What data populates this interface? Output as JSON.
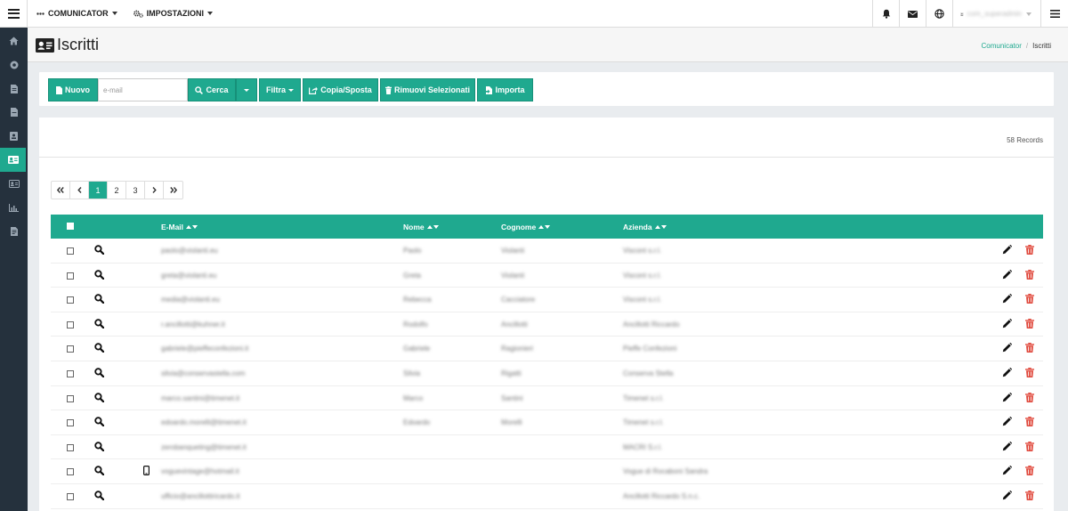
{
  "topbar": {
    "menus": [
      {
        "label": "COMUNICATOR",
        "icon": "dots-icon"
      },
      {
        "label": "IMPOSTAZIONI",
        "icon": "gears-icon"
      }
    ],
    "user_name": "com_superadmin"
  },
  "page": {
    "title": "Iscritti",
    "breadcrumb": {
      "parent": "Comunicator",
      "current": "Iscritti"
    }
  },
  "toolbar": {
    "new_label": "Nuovo",
    "email_placeholder": "e-mail",
    "search_label": "Cerca",
    "filter_label": "Filtra",
    "copy_move_label": "Copia/Sposta",
    "remove_selected_label": "Rimuovi Selezionati",
    "import_label": "Importa"
  },
  "records_label": "58 Records",
  "pagination": {
    "pages": [
      "1",
      "2",
      "3"
    ],
    "current": "1"
  },
  "table": {
    "columns": {
      "email": "E-Mail",
      "name": "Nome",
      "surname": "Cognome",
      "company": "Azienda"
    },
    "rows": [
      {
        "email": "paolo@violanti.eu",
        "name": "Paolo",
        "surname": "Violanti",
        "company": "Viscont s.r.l.",
        "mobile": false
      },
      {
        "email": "greta@violanti.eu",
        "name": "Greta",
        "surname": "Violanti",
        "company": "Viscont s.r.l.",
        "mobile": false
      },
      {
        "email": "media@violanti.eu",
        "name": "Rebecca",
        "surname": "Cacciatore",
        "company": "Viscont s.r.l.",
        "mobile": false
      },
      {
        "email": "r.ancillotti@kuhner.it",
        "name": "Rodolfo",
        "surname": "Ancillotti",
        "company": "Ancillotti Riccardo",
        "mobile": false
      },
      {
        "email": "gabriele@pieffeconfezioni.it",
        "name": "Gabriele",
        "surname": "Ragionieri",
        "company": "Pieffe Confezioni",
        "mobile": false
      },
      {
        "email": "silvia@conservastella.com",
        "name": "Silvia",
        "surname": "Rigatti",
        "company": "Conserva Stella",
        "mobile": false
      },
      {
        "email": "marco.santini@timenet.it",
        "name": "Marco",
        "surname": "Santini",
        "company": "Timenet s.r.l.",
        "mobile": false
      },
      {
        "email": "edoardo.morelli@timenet.it",
        "name": "Edoardo",
        "surname": "Morelli",
        "company": "Timenet s.r.l.",
        "mobile": false
      },
      {
        "email": "zerobanqueting@timenet.it",
        "name": "",
        "surname": "",
        "company": "MACRI S.r.l.",
        "mobile": false
      },
      {
        "email": "voguevintage@hotmail.it",
        "name": "",
        "surname": "",
        "company": "Vogue di Rocaboni Sandra",
        "mobile": true
      },
      {
        "email": "ufficio@ancillottiricardo.it",
        "name": "",
        "surname": "",
        "company": "Ancillotti Riccardo S.n.c.",
        "mobile": false
      }
    ]
  },
  "colors": {
    "accent": "#1fa98f",
    "sidebar": "#25313d",
    "danger": "#e0493d"
  }
}
